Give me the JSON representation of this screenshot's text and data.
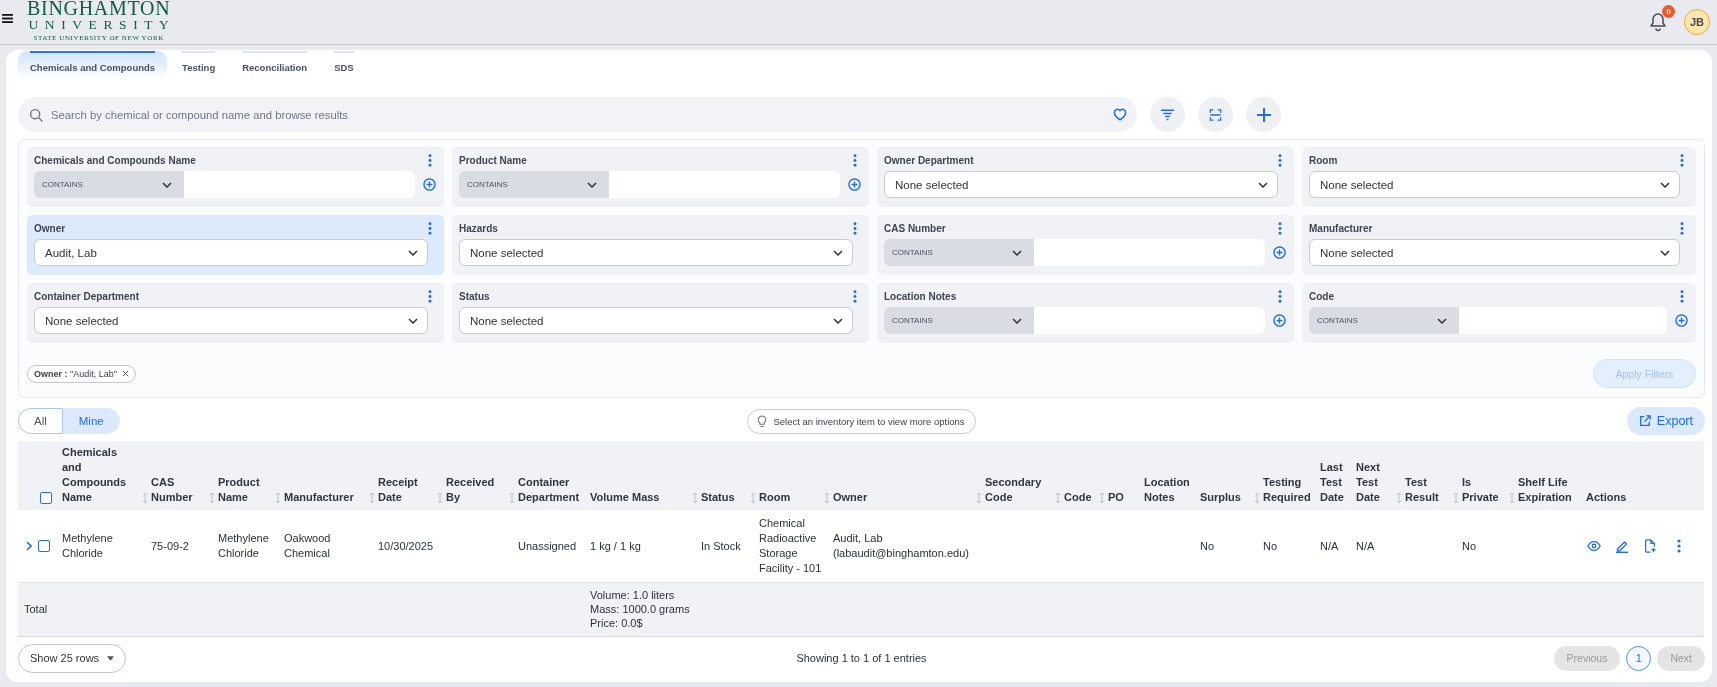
{
  "header": {
    "logo": {
      "line_1": "BINGHAMTON",
      "line_2": "UNIVERSITY",
      "line_3": "STATE UNIVERSITY OF NEW YORK"
    },
    "notification_count": "0",
    "avatar": "JB"
  },
  "tabs": [
    {
      "label": "Chemicals and Compounds",
      "selected": true
    },
    {
      "label": "Testing",
      "selected": false
    },
    {
      "label": "Reconciliation",
      "selected": false
    },
    {
      "label": "SDS",
      "selected": false
    }
  ],
  "search": {
    "placeholder": "Search by chemical or compound name and browse results"
  },
  "filters": [
    {
      "label": "Chemicals and Compounds Name",
      "kind": "text",
      "operator": "CONTAINS",
      "active": false
    },
    {
      "label": "Product Name",
      "kind": "text",
      "operator": "CONTAINS",
      "active": false
    },
    {
      "label": "Owner Department",
      "kind": "select",
      "value": "None selected",
      "active": false
    },
    {
      "label": "Room",
      "kind": "select",
      "value": "None selected",
      "active": false
    },
    {
      "label": "Owner",
      "kind": "select",
      "value": "Audit, Lab",
      "active": true
    },
    {
      "label": "Hazards",
      "kind": "select",
      "value": "None selected",
      "active": false
    },
    {
      "label": "CAS Number",
      "kind": "text",
      "operator": "CONTAINS",
      "active": false
    },
    {
      "label": "Manufacturer",
      "kind": "select",
      "value": "None selected",
      "active": false
    },
    {
      "label": "Container Department",
      "kind": "select",
      "value": "None selected",
      "active": false
    },
    {
      "label": "Status",
      "kind": "select",
      "value": "None selected",
      "active": false
    },
    {
      "label": "Location Notes",
      "kind": "text",
      "operator": "CONTAINS",
      "active": false
    },
    {
      "label": "Code",
      "kind": "text",
      "operator": "CONTAINS",
      "active": false
    }
  ],
  "applied_filters": [
    {
      "text": "**Owner :** \"Audit, Lab\""
    }
  ],
  "apply_button": {
    "label": "Apply Filters",
    "disabled": true
  },
  "view_toggle": [
    {
      "label": "All",
      "selected": false
    },
    {
      "label": "Mine",
      "selected": true
    }
  ],
  "hint": "Select an inventory item to view more options",
  "export_button": "Export",
  "table": {
    "select_all": {
      "checked": false
    },
    "columns": [
      {
        "label": "Chemicals and Compounds Name",
        "sortable": true
      },
      {
        "label": "CAS Number",
        "sortable": true
      },
      {
        "label": "Product Name",
        "sortable": true
      },
      {
        "label": "Manufacturer",
        "sortable": true
      },
      {
        "label": "Receipt Date",
        "sortable": true
      },
      {
        "label": "Received By",
        "sortable": true
      },
      {
        "label": "Container Department",
        "sortable": false
      },
      {
        "label": "Volume Mass",
        "sortable": true
      },
      {
        "label": "Status",
        "sortable": true
      },
      {
        "label": "Room",
        "sortable": true
      },
      {
        "label": "Owner",
        "sortable": true
      },
      {
        "label": "Secondary Code",
        "sortable": true
      },
      {
        "label": "Code",
        "sortable": true
      },
      {
        "label": "PO",
        "sortable": false
      },
      {
        "label": "Location Notes",
        "sortable": false
      },
      {
        "label": "Surplus",
        "sortable": true
      },
      {
        "label": "Testing Required",
        "sortable": false
      },
      {
        "label": "Last Test Date",
        "sortable": false
      },
      {
        "label": "Next Test Date",
        "sortable": true
      },
      {
        "label": "Test Result",
        "sortable": true
      },
      {
        "label": "Is Private",
        "sortable": true
      },
      {
        "label": "Shelf Life Expiration",
        "sortable": false
      },
      {
        "label": "Actions",
        "sortable": false
      }
    ],
    "rows": [
      {
        "expanded": false,
        "checked": false,
        "cells": [
          "Methylene Chloride",
          "75-09-2",
          "Methylene Chloride",
          "Oakwood Chemical",
          "10/30/2025",
          null,
          "Unassigned",
          "1 kg / 1 kg",
          "In Stock",
          "Chemical Radioactive Storage Facility - 101",
          "Audit, Lab (labaudit@binghamton.edu)",
          null,
          null,
          null,
          null,
          "No",
          "No",
          "N/A",
          "N/A",
          null,
          "No",
          null
        ]
      }
    ],
    "total": {
      "label": "Total",
      "cells": [
        null,
        null,
        null,
        null,
        null,
        null,
        null,
        [
          "Volume: 1.0 liters",
          "Mass: 1000.0 grams",
          "Price: 0.0$"
        ],
        null,
        null,
        null,
        null,
        null,
        null,
        null,
        null,
        null,
        null,
        null,
        null,
        null,
        null
      ]
    }
  },
  "footer": {
    "page_size": "Show 25 rows",
    "summary": "Showing 1 to 1 of 1 entries",
    "previous": {
      "label": "Previous",
      "disabled": true
    },
    "pages": [
      {
        "label": "1",
        "selected": true
      }
    ],
    "next": {
      "label": "Next",
      "disabled": true
    }
  }
}
